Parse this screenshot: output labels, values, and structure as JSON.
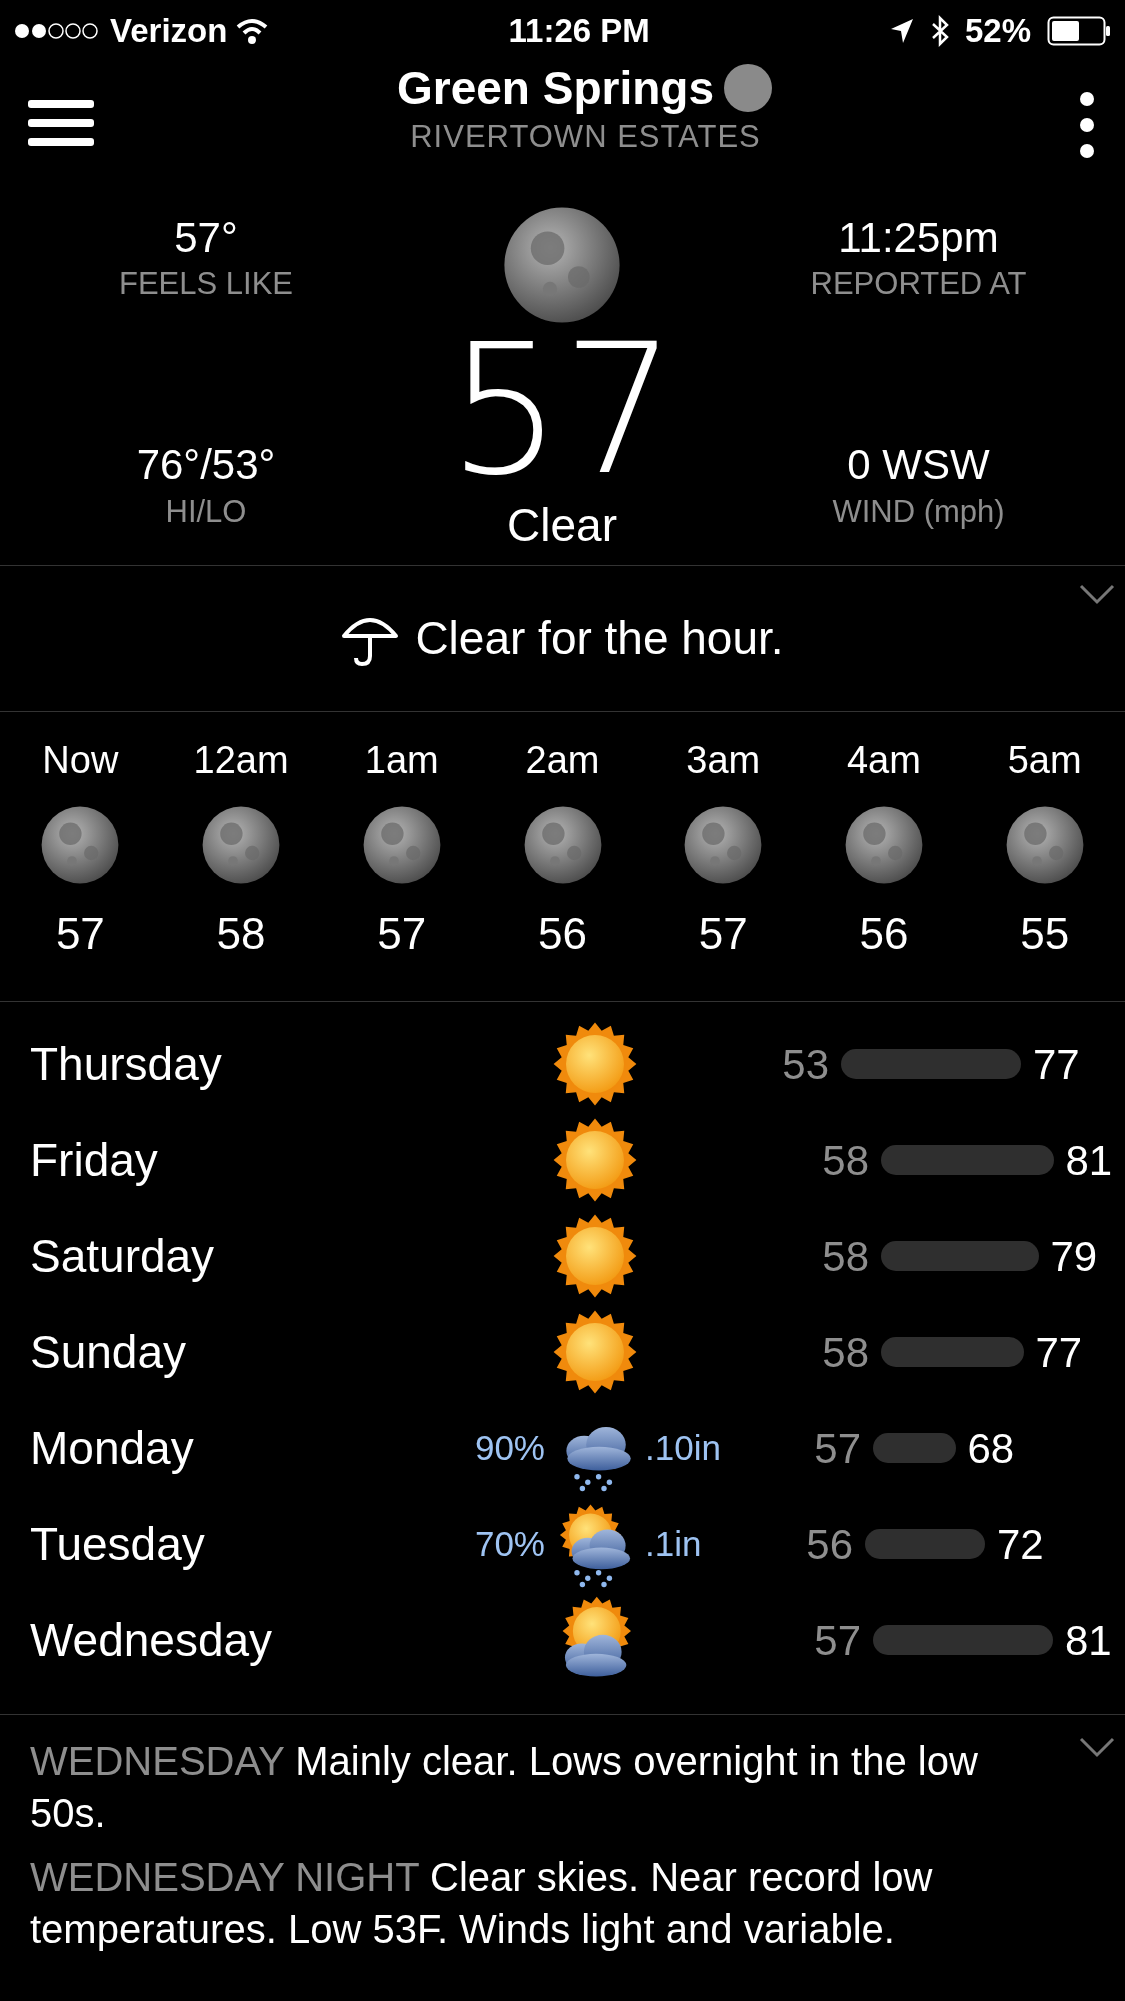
{
  "status_bar": {
    "carrier": "Verizon",
    "time": "11:26 PM",
    "battery": "52%"
  },
  "header": {
    "title": "Green Springs",
    "subtitle": "RIVERTOWN ESTATES"
  },
  "current": {
    "feels_like": "57°",
    "feels_like_label": "FEELS LIKE",
    "hi_lo": "76°/53°",
    "hi_lo_label": "HI/LO",
    "temperature": "57",
    "condition": "Clear",
    "reported": "11:25pm",
    "reported_label": "REPORTED AT",
    "wind": "0 WSW",
    "wind_label": "WIND (mph)"
  },
  "hour_summary": "Clear for the hour.",
  "hourly": [
    {
      "time": "Now",
      "temp": "57"
    },
    {
      "time": "12am",
      "temp": "58"
    },
    {
      "time": "1am",
      "temp": "57"
    },
    {
      "time": "2am",
      "temp": "56"
    },
    {
      "time": "3am",
      "temp": "57"
    },
    {
      "time": "4am",
      "temp": "56"
    },
    {
      "time": "5am",
      "temp": "55"
    }
  ],
  "daily": [
    {
      "day": "Thursday",
      "kind": "sun",
      "low": "53",
      "high": "77"
    },
    {
      "day": "Friday",
      "kind": "sun",
      "low": "58",
      "high": "81"
    },
    {
      "day": "Saturday",
      "kind": "sun",
      "low": "58",
      "high": "79"
    },
    {
      "day": "Sunday",
      "kind": "sun",
      "low": "58",
      "high": "77"
    },
    {
      "day": "Monday",
      "kind": "rain",
      "precip": "90%",
      "amount": ".10in",
      "low": "57",
      "high": "68"
    },
    {
      "day": "Tuesday",
      "kind": "sun-rain",
      "precip": "70%",
      "amount": ".1in",
      "low": "56",
      "high": "72"
    },
    {
      "day": "Wednesday",
      "kind": "sun-cloud",
      "low": "57",
      "high": "81"
    }
  ],
  "forecast": [
    {
      "period": "WEDNESDAY",
      "text": "Mainly clear. Lows overnight in the low 50s."
    },
    {
      "period": "WEDNESDAY NIGHT",
      "text": "Clear skies. Near record low temperatures. Low 53F. Winds light and variable."
    }
  ]
}
